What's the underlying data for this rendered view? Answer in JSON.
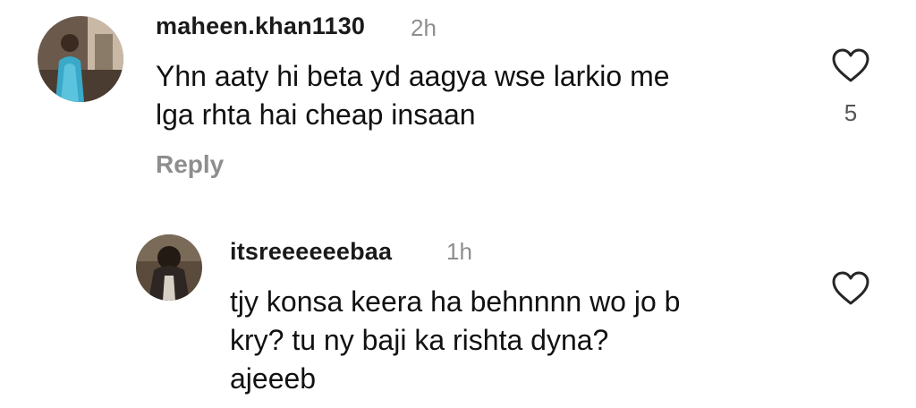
{
  "comments": [
    {
      "username": "maheen.khan1130",
      "time": "2h",
      "text": "Yhn aaty hi beta yd aagya wse larkio me\nlga rhta hai cheap insaan",
      "reply_label": "Reply",
      "like_count": "5",
      "heart_icon": "heart-outline-icon"
    },
    {
      "username": "itsreeeeeebaa",
      "time": "1h",
      "text": "tjy konsa keera ha behnnnn wo jo b\nkry? tu ny baji ka rishta dyna?\najeeeb",
      "heart_icon": "heart-outline-icon"
    }
  ]
}
